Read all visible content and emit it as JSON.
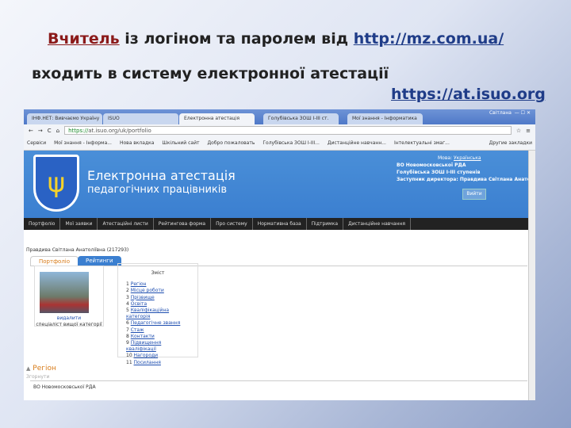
{
  "slide": {
    "line1_pre": "Вчитель",
    "line1_mid": " із логіном та паролем від ",
    "line1_link": "http://mz.com.ua/",
    "line2": "входить в систему електронної атестації",
    "line3_link": "https://at.isuo.org"
  },
  "browser": {
    "tabs": [
      "ІНФ.НЕТ: Вивчаємо Україну",
      "ISUO",
      "Електронна атестація",
      "Голубівська ЗОШ І-ІІІ ст.",
      "Мої знання - Інформатика"
    ],
    "user": "Світлана",
    "url_secure": "https://",
    "url_rest": "at.isuo.org/uk/portfolio",
    "bookmarks": [
      "Сервіси",
      "Мої знання - Інформа...",
      "Нова вкладка",
      "Шкільний сайт",
      "Добро пожаловать",
      "Голубівська ЗОШ І-ІІІ...",
      "Дистанційне навчанн...",
      "Інтелектуальні змаг...",
      "Другие закладки"
    ]
  },
  "site": {
    "title1": "Електронна атестація",
    "title2": "педагогічних працівників",
    "lang_label": "Мова:",
    "lang": "Українська",
    "org1": "ВО Новомосковської РДА",
    "org2": "Голубівська ЗОШ І-ІІІ ступенів",
    "role": "Заступник директора: Правдива Світлана Анатоліївна",
    "exit": "Вийти",
    "nav": [
      "Портфоліо",
      "Мої заявки",
      "Атестаційні листи",
      "Рейтингова форма",
      "Про систему",
      "Нормативна база",
      "Підтримка",
      "Дистанційне навчання"
    ],
    "person": "Правдива Світлана Анатоліївна (217293)",
    "tab_portfolio": "Портфоліо",
    "tab_ratings": "Рейтинги",
    "photo_delete": "видалити",
    "photo_caption": "спеціаліст вищої категорії",
    "toc_title": "Зміст",
    "toc": [
      "Регіон",
      "Місце роботи",
      "Прізвище",
      "Освіта",
      "Кваліфікаційна категорія",
      "Педагогічне звання",
      "Стаж",
      "Контакти",
      "Підвищення кваліфікації",
      "Нагороди",
      "Посилання"
    ],
    "section": "Регіон",
    "section_sub": "Згорнути",
    "region_value": "ВО Новомосковської РДА"
  }
}
